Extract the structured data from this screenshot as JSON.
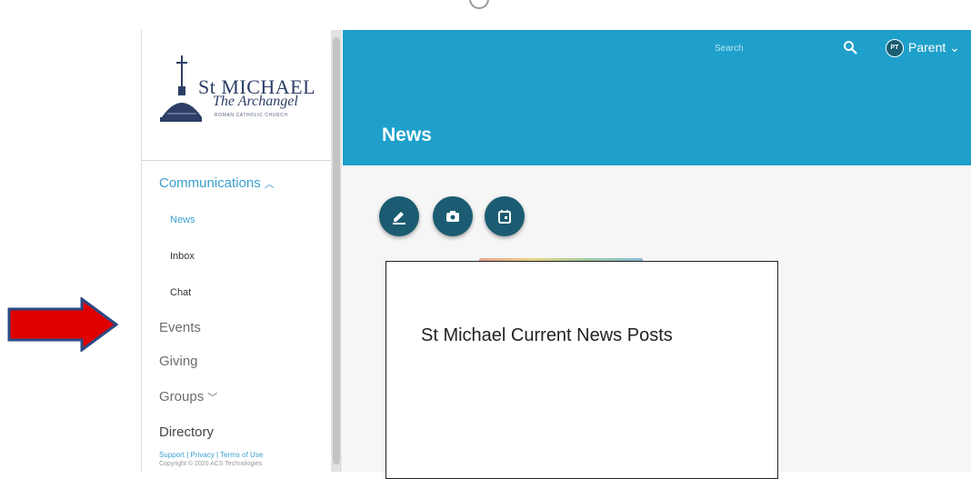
{
  "logo": {
    "line1": "St MICHAEL",
    "line2": "The Archangel",
    "line3": "ROMAN CATHOLIC CHURCH"
  },
  "nav": {
    "communications": "Communications",
    "news": "News",
    "inbox": "Inbox",
    "chat": "Chat",
    "events": "Events",
    "giving": "Giving",
    "groups": "Groups",
    "directory": "Directory"
  },
  "footer": {
    "links": "Support | Privacy | Terms of Use",
    "copyright": "Copyright © 2020 ACS Technologies"
  },
  "header": {
    "search_placeholder": "Search",
    "avatar_initials": "PT",
    "user_name": "Parent",
    "page_title": "News"
  },
  "card": {
    "text": "St Michael Current News Posts"
  },
  "colors": {
    "header": "#1ea0cb",
    "accent": "#3c9fcf",
    "fab": "#1b5c72",
    "arrow": "#e00000"
  },
  "icons": {
    "search": "search-icon",
    "chevron": "chevron-down-icon",
    "post": "edit-icon",
    "photo": "camera-icon",
    "event": "calendar-icon"
  }
}
